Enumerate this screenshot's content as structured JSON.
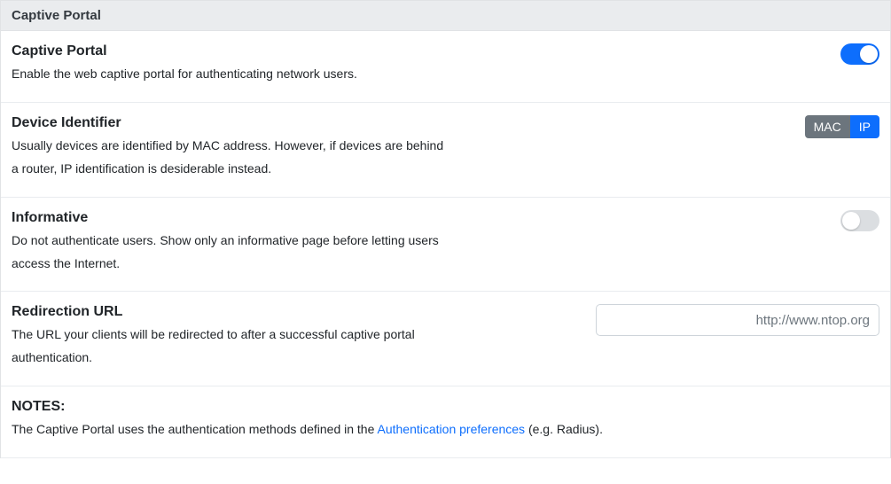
{
  "header": {
    "title": "Captive Portal"
  },
  "rows": {
    "captive": {
      "title": "Captive Portal",
      "desc": "Enable the web captive portal for authenticating network users.",
      "toggle_on": true
    },
    "device": {
      "title": "Device Identifier",
      "desc": "Usually devices are identified by MAC address. However, if devices are behind a router, IP identification is desiderable instead.",
      "seg_mac": "MAC",
      "seg_ip": "IP"
    },
    "informative": {
      "title": "Informative",
      "desc": "Do not authenticate users. Show only an informative page before letting users access the Internet.",
      "toggle_on": false
    },
    "redirect": {
      "title": "Redirection URL",
      "desc": "The URL your clients will be redirected to after a successful captive portal authentication.",
      "placeholder": "http://www.ntop.org"
    }
  },
  "notes": {
    "title": "NOTES:",
    "line_prefix": "The Captive Portal uses the authentication methods defined in the ",
    "link_text": "Authentication preferences",
    "line_suffix": " (e.g. Radius)."
  }
}
